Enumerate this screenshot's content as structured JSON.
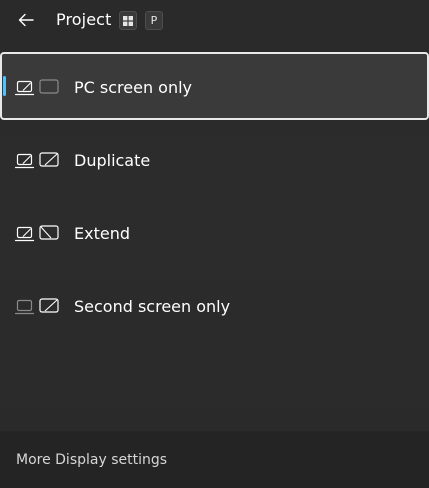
{
  "header": {
    "title": "Project",
    "shortcut_keys": [
      "⊞",
      "P"
    ]
  },
  "options": [
    {
      "label": "PC screen only",
      "icon": "pc-screen-only-icon",
      "selected": true
    },
    {
      "label": "Duplicate",
      "icon": "duplicate-icon",
      "selected": false
    },
    {
      "label": "Extend",
      "icon": "extend-icon",
      "selected": false
    },
    {
      "label": "Second screen only",
      "icon": "second-screen-only-icon",
      "selected": false
    }
  ],
  "footer": {
    "link_label": "More Display settings"
  },
  "colors": {
    "accent": "#4cc2ff",
    "background": "#2b2b2b",
    "selected_bg": "#3a3a3a"
  }
}
